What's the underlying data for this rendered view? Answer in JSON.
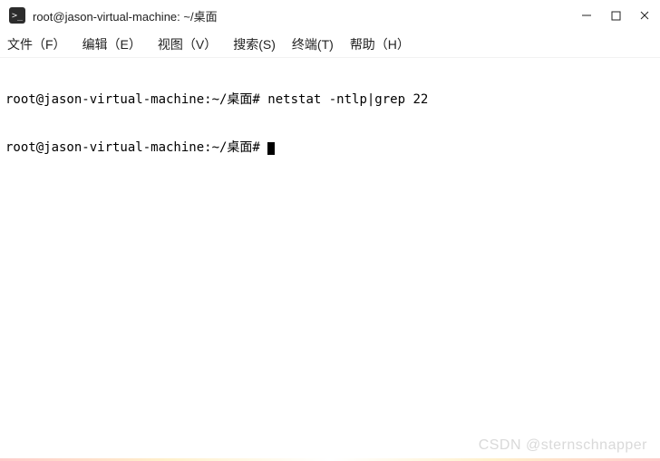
{
  "window": {
    "title": "root@jason-virtual-machine: ~/桌面",
    "icon_glyph": ">_"
  },
  "menu": {
    "items": [
      "文件（F）",
      "编辑（E）",
      "视图（V）",
      "搜索(S)",
      "终端(T)",
      "帮助（H）"
    ]
  },
  "terminal": {
    "lines": [
      {
        "prompt": "root@jason-virtual-machine:~/桌面# ",
        "cmd": "netstat -ntlp|grep 22"
      },
      {
        "prompt": "root@jason-virtual-machine:~/桌面# ",
        "cmd": ""
      }
    ]
  },
  "watermark": "CSDN @sternschnapper"
}
